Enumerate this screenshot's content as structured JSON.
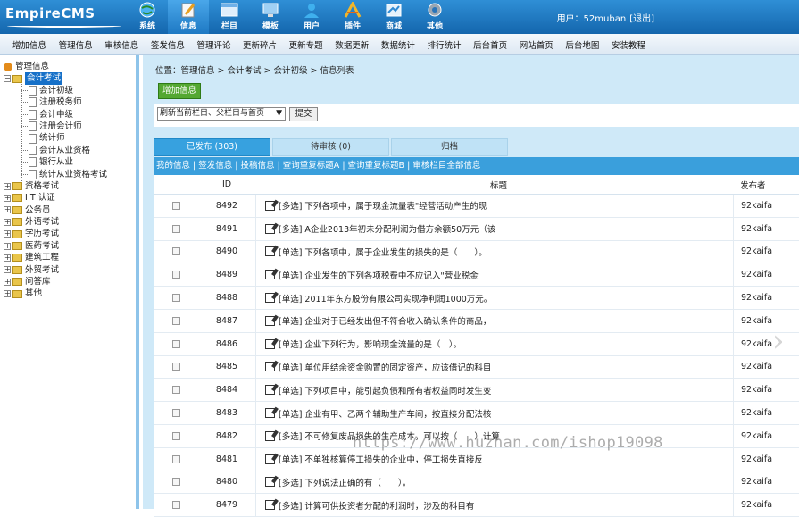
{
  "app": {
    "logo": "EmpireCMS"
  },
  "nav": [
    {
      "label": "系统",
      "icon": "globe-icon"
    },
    {
      "label": "信息",
      "icon": "edit-icon",
      "active": true
    },
    {
      "label": "栏目",
      "icon": "window-icon"
    },
    {
      "label": "模板",
      "icon": "monitor-icon"
    },
    {
      "label": "用户",
      "icon": "user-icon"
    },
    {
      "label": "插件",
      "icon": "tools-icon"
    },
    {
      "label": "商城",
      "icon": "store-icon"
    },
    {
      "label": "其他",
      "icon": "gear-icon"
    }
  ],
  "user": {
    "text": "用户：52muban",
    "logout": "[退出]"
  },
  "subnav": [
    "增加信息",
    "管理信息",
    "审核信息",
    "签发信息",
    "管理评论",
    "更新碎片",
    "更新专题",
    "数据更新",
    "数据统计",
    "排行统计",
    "后台首页",
    "网站首页",
    "后台地图",
    "安装教程"
  ],
  "sidebar": {
    "root": "管理信息",
    "open_category": "会计考试",
    "children": [
      "会计初级",
      "注册税务师",
      "会计中级",
      "注册会计师",
      "统计师",
      "会计从业资格",
      "银行从业",
      "统计从业资格考试"
    ],
    "categories": [
      "资格考试",
      "I T 认证",
      "公务员",
      "外语考试",
      "学历考试",
      "医药考试",
      "建筑工程",
      "外贸考试",
      "问答库",
      "其他"
    ]
  },
  "breadcrumb": "位置：管理信息 > 会计考试 > 会计初级 > 信息列表",
  "add_button": "增加信息",
  "refresh_select": "刷新当前栏目、父栏目与首页",
  "submit_button": "提交",
  "tabs": [
    "已发布 (303)",
    "待审核 (0)",
    "归档"
  ],
  "quick_links": [
    "我的信息",
    "签发信息",
    "投稿信息",
    "查询重复标题A",
    "查询重复标题B",
    "审核栏目全部信息"
  ],
  "table": {
    "headers": {
      "id": "ID",
      "title": "标题",
      "publisher": "发布者"
    },
    "rows": [
      {
        "id": "8492",
        "title": "[多选] 下列各项中，属于现金流量表\"经营活动产生的现",
        "publisher": "92kaifa"
      },
      {
        "id": "8491",
        "title": "[多选] A企业2013年初未分配利润为借方余额50万元（该",
        "publisher": "92kaifa"
      },
      {
        "id": "8490",
        "title": "[单选] 下列各项中，属于企业发生的损失的是（　　）。",
        "publisher": "92kaifa"
      },
      {
        "id": "8489",
        "title": "[单选] 企业发生的下列各项税费中不应记入\"营业税金",
        "publisher": "92kaifa"
      },
      {
        "id": "8488",
        "title": "[单选] 2011年东方股份有限公司实现净利润1000万元。",
        "publisher": "92kaifa"
      },
      {
        "id": "8487",
        "title": "[单选] 企业对于已经发出但不符合收入确认条件的商品，",
        "publisher": "92kaifa"
      },
      {
        "id": "8486",
        "title": "[单选] 企业下列行为，影响现金流量的是（　）。",
        "publisher": "92kaifa"
      },
      {
        "id": "8485",
        "title": "[单选] 单位用结余资金购置的固定资产，应该借记的科目",
        "publisher": "92kaifa"
      },
      {
        "id": "8484",
        "title": "[单选] 下列项目中，能引起负债和所有者权益同时发生变",
        "publisher": "92kaifa"
      },
      {
        "id": "8483",
        "title": "[单选] 企业有甲、乙两个辅助生产车间，按直接分配法核",
        "publisher": "92kaifa"
      },
      {
        "id": "8482",
        "title": "[多选] 不可修复废品损失的生产成本，可以按（　　）计算",
        "publisher": "92kaifa"
      },
      {
        "id": "8481",
        "title": "[单选] 不单独核算停工损失的企业中，停工损失直接反",
        "publisher": "92kaifa"
      },
      {
        "id": "8480",
        "title": "[多选] 下列说法正确的有（　　）。",
        "publisher": "92kaifa"
      },
      {
        "id": "8479",
        "title": "[多选] 计算可供投资者分配的利润时，涉及的科目有",
        "publisher": "92kaifa"
      }
    ]
  },
  "watermark": "https://www.huzhan.com/ishop19098",
  "colors": {
    "header": "#1f7ac4",
    "tab_active": "#37a1df",
    "add_button": "#54a832",
    "main_bg": "#cfe9f8"
  }
}
